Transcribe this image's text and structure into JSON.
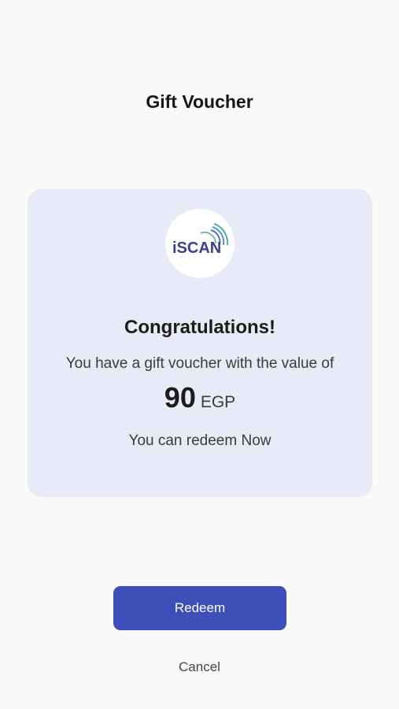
{
  "header": {
    "title": "Gift Voucher"
  },
  "voucher": {
    "logo": {
      "icon": "iscan-logo-icon",
      "text": "iSCAN"
    },
    "heading": "Congratulations!",
    "message": "You have a gift voucher with the value of",
    "amount": "90",
    "currency": "EGP",
    "redeem_note": "You can redeem Now"
  },
  "actions": {
    "redeem_label": "Redeem",
    "cancel_label": "Cancel"
  },
  "colors": {
    "primary": "#3d4fb8",
    "card_background": "#e9eaf7",
    "page_background": "#fafafa"
  }
}
